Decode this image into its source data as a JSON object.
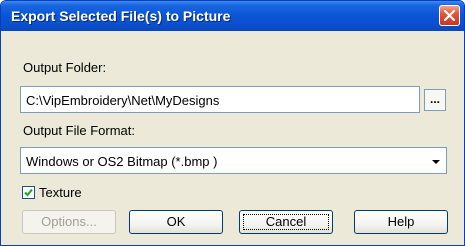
{
  "dialog": {
    "title": "Export Selected File(s) to Picture"
  },
  "output_folder": {
    "label": "Output Folder:",
    "value": "C:\\VipEmbroidery\\Net\\MyDesigns",
    "browse_label": "..."
  },
  "output_format": {
    "label": "Output File Format:",
    "selected": "Windows or OS2 Bitmap (*.bmp )"
  },
  "texture": {
    "label": "Texture",
    "checked": true
  },
  "buttons": {
    "options": "Options...",
    "ok": "OK",
    "cancel": "Cancel",
    "help": "Help"
  },
  "colors": {
    "title_bar": "#0a55d6",
    "dialog_face": "#ece9d8",
    "close_button": "#e4553a",
    "checkmark": "#21a121"
  },
  "icons": {
    "close": "close-icon",
    "dropdown": "chevron-down-icon",
    "checkmark": "checkmark-icon"
  }
}
